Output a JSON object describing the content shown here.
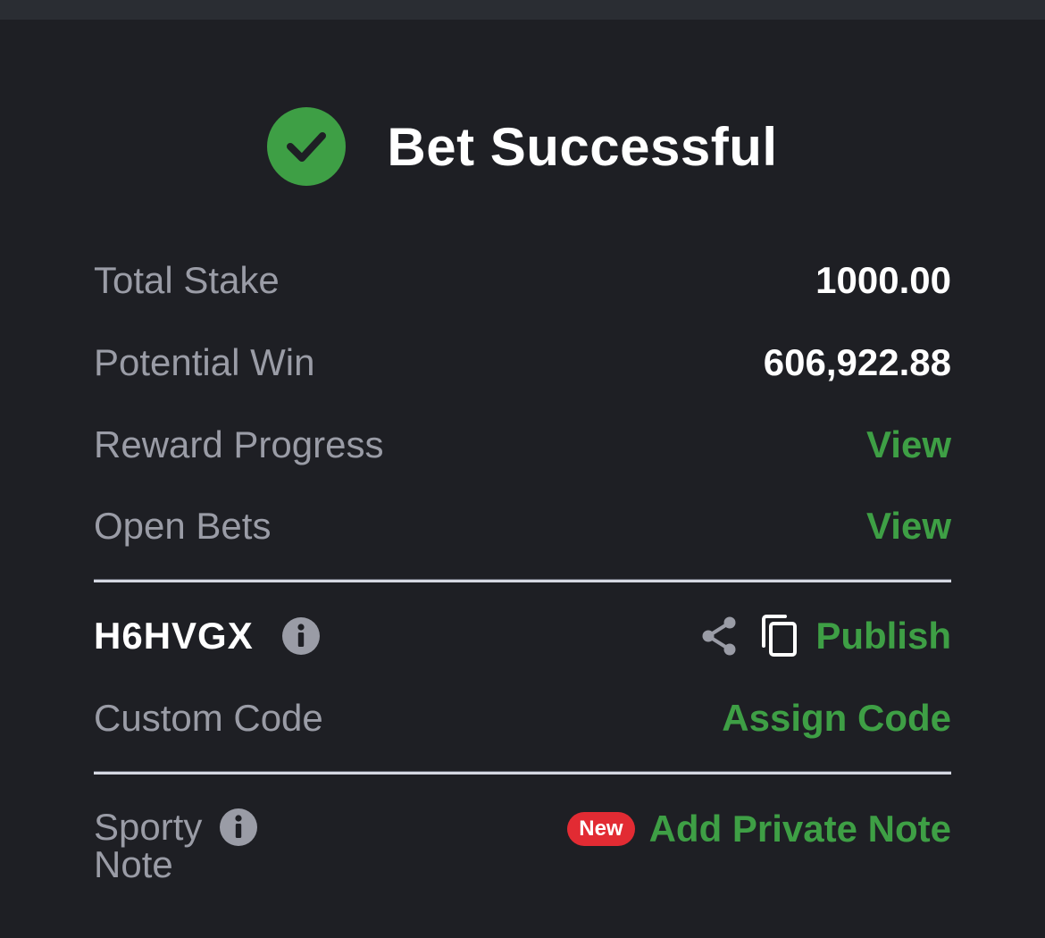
{
  "header": {
    "title": "Bet Successful"
  },
  "summary": {
    "total_stake_label": "Total Stake",
    "total_stake_value": "1000.00",
    "potential_win_label": "Potential Win",
    "potential_win_value": "606,922.88",
    "reward_progress_label": "Reward Progress",
    "reward_progress_link": "View",
    "open_bets_label": "Open Bets",
    "open_bets_link": "View"
  },
  "booking": {
    "code": "H6HVGX",
    "publish_label": "Publish",
    "custom_code_label": "Custom Code",
    "assign_code_label": "Assign Code"
  },
  "note": {
    "label_line1": "Sporty",
    "label_line2": "Note",
    "badge": "New",
    "add_label": "Add Private Note"
  },
  "colors": {
    "accent": "#3e9f45",
    "background": "#1e1f24",
    "badge": "#e22b33"
  }
}
